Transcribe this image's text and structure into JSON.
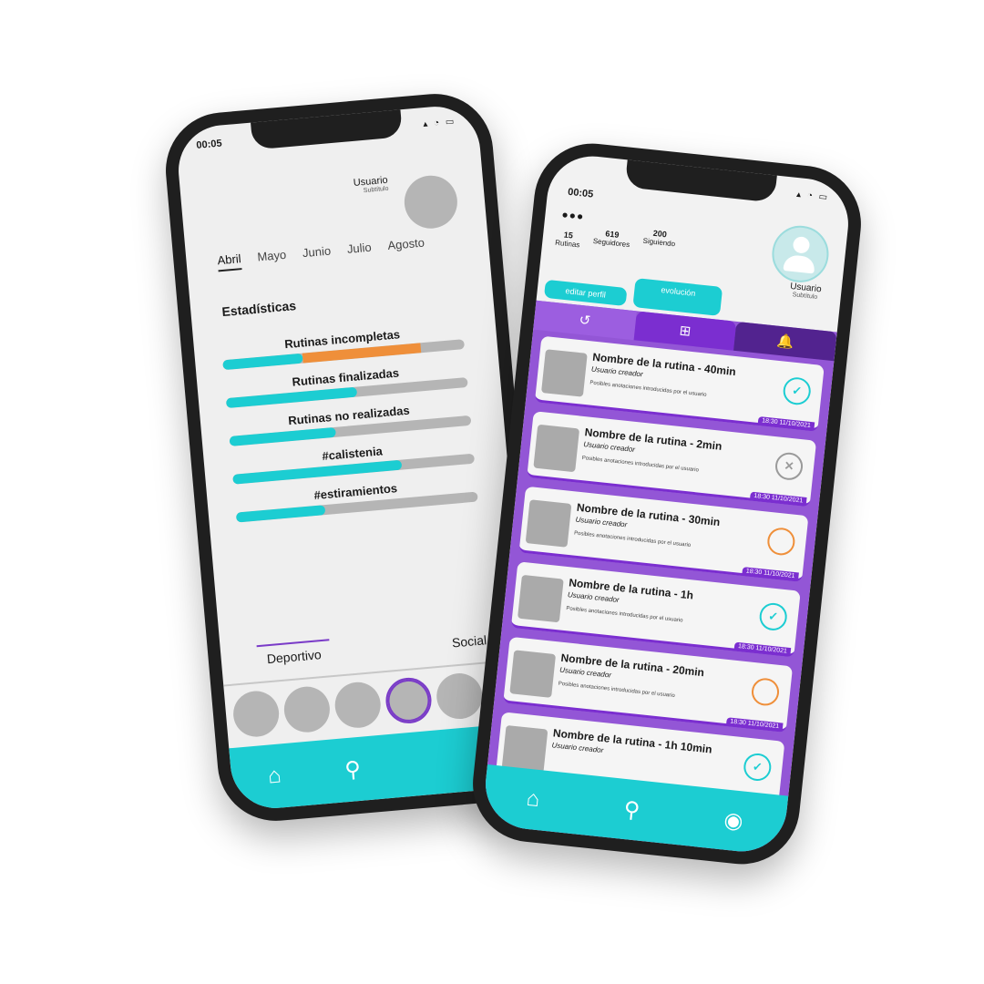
{
  "left_phone": {
    "time": "00:05",
    "status_icons": "▴ ◔ ▭",
    "user": {
      "name": "Usuario",
      "subtitle": "Subtítulo"
    },
    "months": [
      "Abril",
      "Mayo",
      "Junio",
      "Julio",
      "Agosto"
    ],
    "stats_title": "Estadísticas",
    "stats": [
      {
        "label": "Rutinas incompletas",
        "fill": 0.33,
        "fill2": 0.49,
        "color2": "#ef8f3a"
      },
      {
        "label": "Rutinas finalizadas",
        "fill": 0.54
      },
      {
        "label": "Rutinas no realizadas",
        "fill": 0.44
      },
      {
        "label": "#calistenia",
        "fill": 0.7
      },
      {
        "label": "#estiramientos",
        "fill": 0.37
      }
    ],
    "tabs": {
      "deportivo": "Deportivo",
      "social": "Social"
    },
    "nav": {
      "home_icon": "⌂",
      "search_icon": "⚲"
    }
  },
  "right_phone": {
    "time": "00:05",
    "dots": "●●●",
    "status_icons": "▴ ◔ ▭",
    "user": {
      "name": "Usuario",
      "subtitle": "Subtítulo"
    },
    "counters": [
      {
        "value": "15",
        "label": "Rutinas"
      },
      {
        "value": "619",
        "label": "Seguidores"
      },
      {
        "value": "200",
        "label": "Siguiendo"
      }
    ],
    "buttons": {
      "edit": "editar perfil",
      "evolution": "evolución"
    },
    "tabs": {
      "history_icon": "↺",
      "add_icon": "⊞",
      "bell_icon": "🔔"
    },
    "routines": [
      {
        "title": "Nombre de la rutina - 40min",
        "creator": "Usuario creador",
        "note": "Posibles anotaciones introducidas por el usuario",
        "date": "18:30 11/10/2021",
        "status": "ok",
        "status_icon": "✓"
      },
      {
        "title": "Nombre de la rutina - 2min",
        "creator": "Usuario creador",
        "note": "Posibles anotaciones introducidas por el usuario",
        "date": "18:30 11/10/2021",
        "status": "fail",
        "status_icon": "✕"
      },
      {
        "title": "Nombre de la rutina - 30min",
        "creator": "Usuario creador",
        "note": "Posibles anotaciones introducidas por el usuario",
        "date": "18:30 11/10/2021",
        "status": "pend",
        "status_icon": ""
      },
      {
        "title": "Nombre de la rutina - 1h",
        "creator": "Usuario creador",
        "note": "Posibles anotaciones introducidas por el usuario",
        "date": "18:30 11/10/2021",
        "status": "ok",
        "status_icon": "✓"
      },
      {
        "title": "Nombre de la rutina - 20min",
        "creator": "Usuario creador",
        "note": "Posibles anotaciones introducidas por el usuario",
        "date": "18:30 11/10/2021",
        "status": "pend",
        "status_icon": ""
      },
      {
        "title": "Nombre de la rutina - 1h 10min",
        "creator": "Usuario creador",
        "note": "",
        "date": "",
        "status": "ok",
        "status_icon": "✓"
      }
    ],
    "nav": {
      "home_icon": "⌂",
      "search_icon": "⚲",
      "profile_icon": "◉"
    }
  },
  "colors": {
    "accent": "#1ccdd2",
    "purple": "#9356d6",
    "orange": "#ef8f3a"
  }
}
